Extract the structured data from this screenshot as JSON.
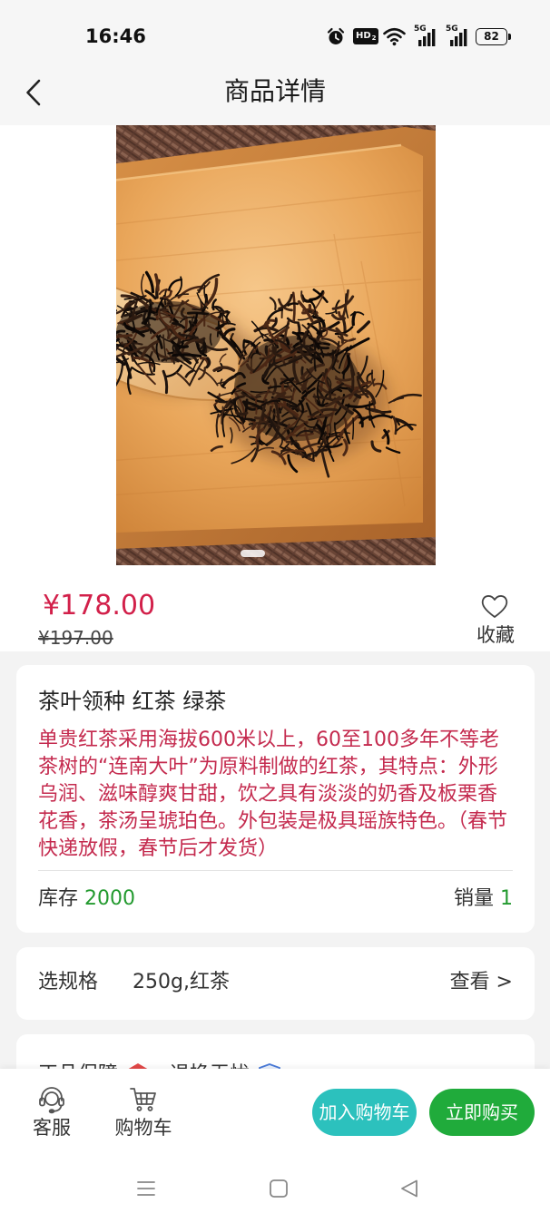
{
  "status_bar": {
    "time": "16:46",
    "hd_badge": "HD",
    "hd_badge_sub": "2",
    "network_1": "5G",
    "network_2": "5G",
    "battery": "82",
    "icons": [
      "alarm-icon",
      "hd-voice-icon",
      "wifi-icon",
      "signal-icon",
      "signal-icon",
      "battery-icon"
    ]
  },
  "header": {
    "title": "商品详情",
    "back_icon": "chevron-left-icon"
  },
  "product": {
    "price": "¥178.00",
    "original_price": "¥197.00",
    "favorite_label": "收藏",
    "favorite_icon": "heart-outline-icon"
  },
  "info_card": {
    "title": "茶叶领种 红茶 绿茶",
    "description": "单贵红茶采用海拔600米以上，60至100多年不等老茶树的“连南大叶”为原料制做的红茶，其特点：外形乌润、滋味醇爽甘甜，饮之具有淡淡的奶香及板栗香花香，茶汤呈琥珀色。外包装是极具瑶族特色。（春节快递放假，春节后才发货）",
    "stock_label": "库存",
    "stock_value": "2000",
    "sales_label": "销量",
    "sales_value": "1"
  },
  "spec_card": {
    "label": "选规格",
    "value": "250g,红茶",
    "action": "查看 >"
  },
  "guarantee_card": {
    "items": [
      {
        "label": "正品保障",
        "icon": "authentic-badge-icon"
      },
      {
        "label": "退换无忧",
        "icon": "return-shield-icon",
        "icon_char": "退"
      }
    ]
  },
  "bottom_bar": {
    "service_label": "客服",
    "service_icon": "headset-icon",
    "cart_label": "购物车",
    "cart_icon": "cart-icon",
    "add_to_cart_label": "加入购物车",
    "buy_now_label": "立即购买"
  },
  "system_nav": {
    "icons": [
      "menu-icon",
      "home-icon",
      "back-triangle-icon"
    ]
  },
  "colors": {
    "price": "#d2204a",
    "description": "#c42a4e",
    "count_value": "#239a2f",
    "add_to_cart_button": "#2cc1bd",
    "buy_now_button": "#20ab3b",
    "page_background": "#f3f3f3",
    "bar_background": "#f6f6f6"
  }
}
